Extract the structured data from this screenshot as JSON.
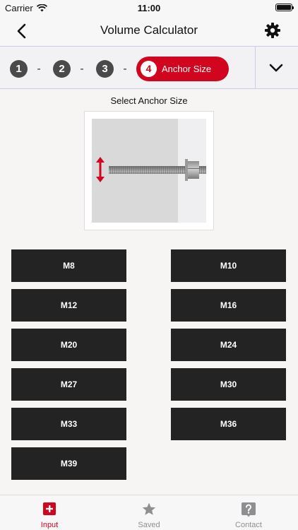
{
  "status_bar": {
    "carrier": "Carrier",
    "time": "11:00"
  },
  "nav": {
    "title": "Volume Calculator",
    "back_icon": "chevron-left-icon",
    "settings_icon": "gear-icon"
  },
  "stepper": {
    "steps": [
      "1",
      "2",
      "3"
    ],
    "separator": "-",
    "active": {
      "number": "4",
      "label": "Anchor Size"
    },
    "expand_icon": "chevron-down-icon",
    "active_color": "#d2051e"
  },
  "section": {
    "label": "Select Anchor Size"
  },
  "sizes": [
    "M8",
    "M10",
    "M12",
    "M16",
    "M20",
    "M24",
    "M27",
    "M30",
    "M33",
    "M36",
    "M39"
  ],
  "tab_bar": {
    "tabs": [
      {
        "label": "Input",
        "icon": "plus-square-icon",
        "active": true
      },
      {
        "label": "Saved",
        "icon": "star-icon",
        "active": false
      },
      {
        "label": "Contact",
        "icon": "question-square-icon",
        "active": false
      }
    ]
  },
  "colors": {
    "accent": "#d2051e",
    "button": "#232323",
    "inactive": "#8e8e93"
  }
}
